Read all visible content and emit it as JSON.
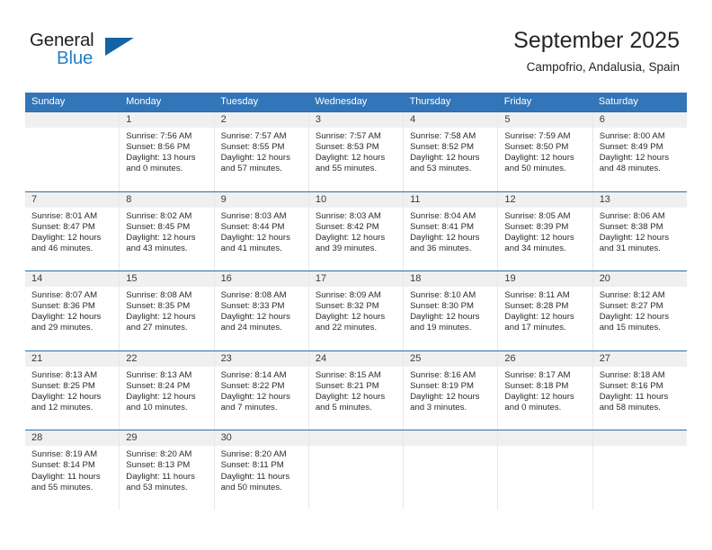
{
  "brand": {
    "name_part1": "General",
    "name_part2": "Blue",
    "triangle_icon": "triangle-icon",
    "accent_color": "#1464a5",
    "blue_text_color": "#2581c4"
  },
  "header": {
    "title": "September 2025",
    "subtitle": "Campofrio, Andalusia, Spain"
  },
  "theme": {
    "header_row_bg": "#3275b8",
    "week_border": "#2e6da4",
    "date_band_bg": "#f0f0f0",
    "cell_divider": "#e8e8e8"
  },
  "weekdays": [
    "Sunday",
    "Monday",
    "Tuesday",
    "Wednesday",
    "Thursday",
    "Friday",
    "Saturday"
  ],
  "weeks": [
    [
      {
        "date": "",
        "lines": []
      },
      {
        "date": "1",
        "lines": [
          "Sunrise: 7:56 AM",
          "Sunset: 8:56 PM",
          "Daylight: 13 hours",
          "and 0 minutes."
        ]
      },
      {
        "date": "2",
        "lines": [
          "Sunrise: 7:57 AM",
          "Sunset: 8:55 PM",
          "Daylight: 12 hours",
          "and 57 minutes."
        ]
      },
      {
        "date": "3",
        "lines": [
          "Sunrise: 7:57 AM",
          "Sunset: 8:53 PM",
          "Daylight: 12 hours",
          "and 55 minutes."
        ]
      },
      {
        "date": "4",
        "lines": [
          "Sunrise: 7:58 AM",
          "Sunset: 8:52 PM",
          "Daylight: 12 hours",
          "and 53 minutes."
        ]
      },
      {
        "date": "5",
        "lines": [
          "Sunrise: 7:59 AM",
          "Sunset: 8:50 PM",
          "Daylight: 12 hours",
          "and 50 minutes."
        ]
      },
      {
        "date": "6",
        "lines": [
          "Sunrise: 8:00 AM",
          "Sunset: 8:49 PM",
          "Daylight: 12 hours",
          "and 48 minutes."
        ]
      }
    ],
    [
      {
        "date": "7",
        "lines": [
          "Sunrise: 8:01 AM",
          "Sunset: 8:47 PM",
          "Daylight: 12 hours",
          "and 46 minutes."
        ]
      },
      {
        "date": "8",
        "lines": [
          "Sunrise: 8:02 AM",
          "Sunset: 8:45 PM",
          "Daylight: 12 hours",
          "and 43 minutes."
        ]
      },
      {
        "date": "9",
        "lines": [
          "Sunrise: 8:03 AM",
          "Sunset: 8:44 PM",
          "Daylight: 12 hours",
          "and 41 minutes."
        ]
      },
      {
        "date": "10",
        "lines": [
          "Sunrise: 8:03 AM",
          "Sunset: 8:42 PM",
          "Daylight: 12 hours",
          "and 39 minutes."
        ]
      },
      {
        "date": "11",
        "lines": [
          "Sunrise: 8:04 AM",
          "Sunset: 8:41 PM",
          "Daylight: 12 hours",
          "and 36 minutes."
        ]
      },
      {
        "date": "12",
        "lines": [
          "Sunrise: 8:05 AM",
          "Sunset: 8:39 PM",
          "Daylight: 12 hours",
          "and 34 minutes."
        ]
      },
      {
        "date": "13",
        "lines": [
          "Sunrise: 8:06 AM",
          "Sunset: 8:38 PM",
          "Daylight: 12 hours",
          "and 31 minutes."
        ]
      }
    ],
    [
      {
        "date": "14",
        "lines": [
          "Sunrise: 8:07 AM",
          "Sunset: 8:36 PM",
          "Daylight: 12 hours",
          "and 29 minutes."
        ]
      },
      {
        "date": "15",
        "lines": [
          "Sunrise: 8:08 AM",
          "Sunset: 8:35 PM",
          "Daylight: 12 hours",
          "and 27 minutes."
        ]
      },
      {
        "date": "16",
        "lines": [
          "Sunrise: 8:08 AM",
          "Sunset: 8:33 PM",
          "Daylight: 12 hours",
          "and 24 minutes."
        ]
      },
      {
        "date": "17",
        "lines": [
          "Sunrise: 8:09 AM",
          "Sunset: 8:32 PM",
          "Daylight: 12 hours",
          "and 22 minutes."
        ]
      },
      {
        "date": "18",
        "lines": [
          "Sunrise: 8:10 AM",
          "Sunset: 8:30 PM",
          "Daylight: 12 hours",
          "and 19 minutes."
        ]
      },
      {
        "date": "19",
        "lines": [
          "Sunrise: 8:11 AM",
          "Sunset: 8:28 PM",
          "Daylight: 12 hours",
          "and 17 minutes."
        ]
      },
      {
        "date": "20",
        "lines": [
          "Sunrise: 8:12 AM",
          "Sunset: 8:27 PM",
          "Daylight: 12 hours",
          "and 15 minutes."
        ]
      }
    ],
    [
      {
        "date": "21",
        "lines": [
          "Sunrise: 8:13 AM",
          "Sunset: 8:25 PM",
          "Daylight: 12 hours",
          "and 12 minutes."
        ]
      },
      {
        "date": "22",
        "lines": [
          "Sunrise: 8:13 AM",
          "Sunset: 8:24 PM",
          "Daylight: 12 hours",
          "and 10 minutes."
        ]
      },
      {
        "date": "23",
        "lines": [
          "Sunrise: 8:14 AM",
          "Sunset: 8:22 PM",
          "Daylight: 12 hours",
          "and 7 minutes."
        ]
      },
      {
        "date": "24",
        "lines": [
          "Sunrise: 8:15 AM",
          "Sunset: 8:21 PM",
          "Daylight: 12 hours",
          "and 5 minutes."
        ]
      },
      {
        "date": "25",
        "lines": [
          "Sunrise: 8:16 AM",
          "Sunset: 8:19 PM",
          "Daylight: 12 hours",
          "and 3 minutes."
        ]
      },
      {
        "date": "26",
        "lines": [
          "Sunrise: 8:17 AM",
          "Sunset: 8:18 PM",
          "Daylight: 12 hours",
          "and 0 minutes."
        ]
      },
      {
        "date": "27",
        "lines": [
          "Sunrise: 8:18 AM",
          "Sunset: 8:16 PM",
          "Daylight: 11 hours",
          "and 58 minutes."
        ]
      }
    ],
    [
      {
        "date": "28",
        "lines": [
          "Sunrise: 8:19 AM",
          "Sunset: 8:14 PM",
          "Daylight: 11 hours",
          "and 55 minutes."
        ]
      },
      {
        "date": "29",
        "lines": [
          "Sunrise: 8:20 AM",
          "Sunset: 8:13 PM",
          "Daylight: 11 hours",
          "and 53 minutes."
        ]
      },
      {
        "date": "30",
        "lines": [
          "Sunrise: 8:20 AM",
          "Sunset: 8:11 PM",
          "Daylight: 11 hours",
          "and 50 minutes."
        ]
      },
      {
        "date": "",
        "lines": []
      },
      {
        "date": "",
        "lines": []
      },
      {
        "date": "",
        "lines": []
      },
      {
        "date": "",
        "lines": []
      }
    ]
  ]
}
